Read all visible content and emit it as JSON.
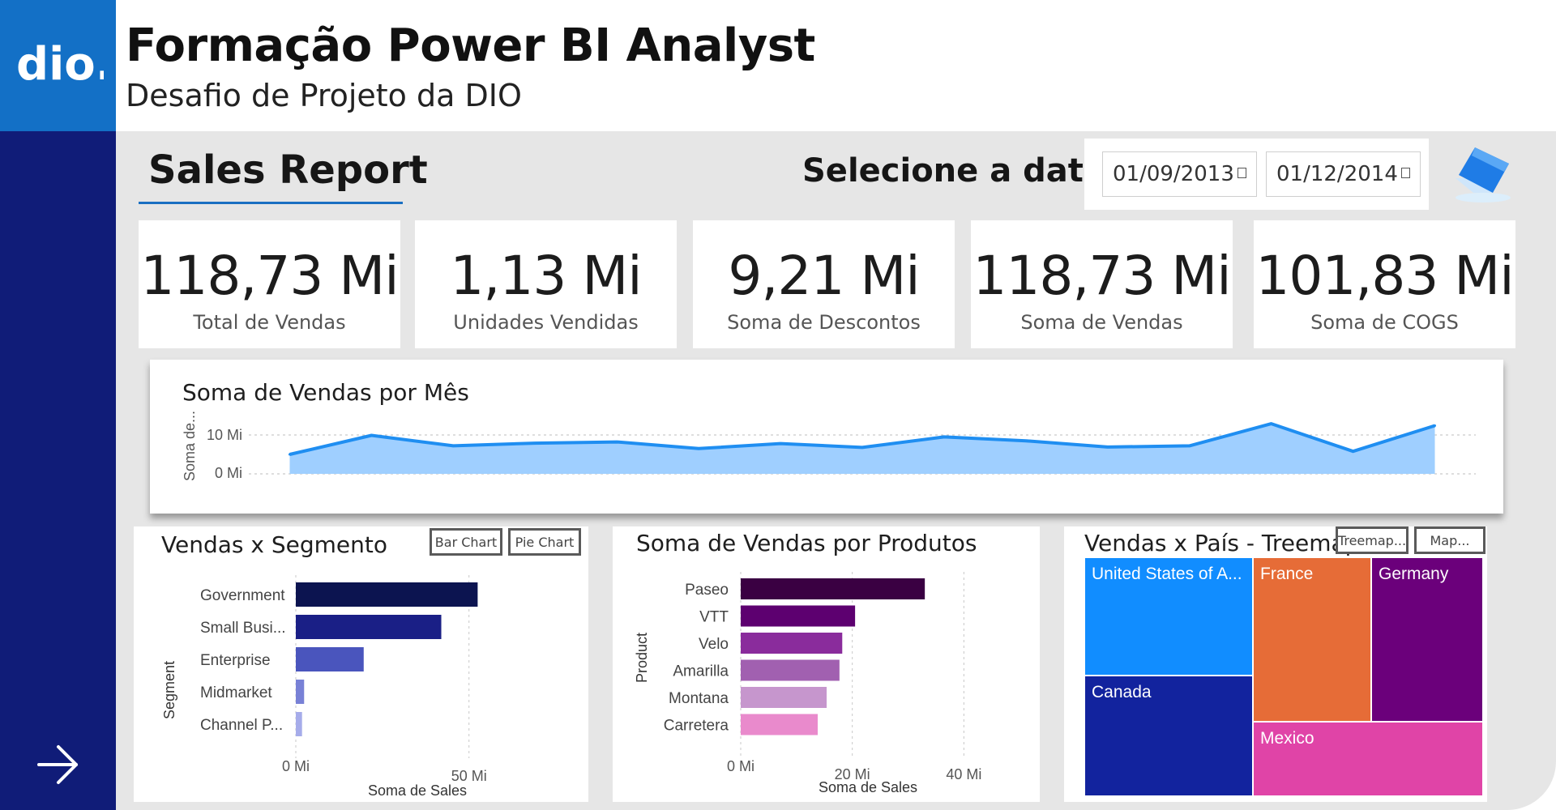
{
  "header": {
    "logo_text": "dio.",
    "title": "Formação Power BI Analyst",
    "subtitle": "Desafio de Projeto da DIO"
  },
  "colors": {
    "brand_blue": "#1370c6",
    "rail_navy": "#101c78",
    "canvas_gray": "#e6e6e6",
    "area_line": "#1f8ef1",
    "area_fill": "#9fcfff"
  },
  "report": {
    "title": "Sales Report",
    "date_label": "Selecione a data",
    "date_start": "01/09/2013",
    "date_end": "01/12/2014",
    "clear_icon": "eraser-icon",
    "nav_icon": "arrow-right-icon"
  },
  "kpis": [
    {
      "value": "118,73 Mi",
      "label": "Total de Vendas"
    },
    {
      "value": "1,13 Mi",
      "label": "Unidades Vendidas"
    },
    {
      "value": "9,21 Mi",
      "label": "Soma de Descontos"
    },
    {
      "value": "118,73 Mi",
      "label": "Soma de Vendas"
    },
    {
      "value": "101,83 Mi",
      "label": "Soma de COGS"
    }
  ],
  "monthly": {
    "title": "Soma de Vendas por Mês",
    "ylabel": "Soma de...",
    "yticks": [
      "10 Mi",
      "0 Mi"
    ]
  },
  "segment": {
    "title": "Vendas x Segmento",
    "buttons": [
      "Bar Chart",
      "Pie Chart"
    ],
    "ylabel": "Segment",
    "xlabel": "Soma de Sales",
    "xticks": [
      "0 Mi",
      "50 Mi"
    ]
  },
  "products": {
    "title": "Soma de Vendas por Produtos",
    "ylabel": "Product",
    "xlabel": "Soma de Sales",
    "xticks": [
      "0 Mi",
      "20 Mi",
      "40 Mi"
    ]
  },
  "country": {
    "title": "Vendas x País - Treemap",
    "buttons": [
      "Treemap...",
      "Map..."
    ],
    "cells": [
      {
        "label": "United States of A...",
        "value": 25.0,
        "color": "#118dff"
      },
      {
        "label": "Canada",
        "value": 24.9,
        "color": "#12239e"
      },
      {
        "label": "France",
        "value": 24.4,
        "color": "#e66c37"
      },
      {
        "label": "Germany",
        "value": 23.5,
        "color": "#6b007b"
      },
      {
        "label": "Mexico",
        "value": 20.9,
        "color": "#e044a7"
      }
    ]
  },
  "chart_data": [
    {
      "type": "area",
      "title": "Soma de Vendas por Mês",
      "xlabel": "",
      "ylabel": "Soma de...",
      "ylim": [
        0,
        14
      ],
      "ytick_values": [
        0,
        10
      ],
      "grid": true,
      "values": [
        5.0,
        9.9,
        7.2,
        7.9,
        8.2,
        6.5,
        7.8,
        6.8,
        9.5,
        8.5,
        6.9,
        7.2,
        12.9,
        5.8,
        12.4
      ]
    },
    {
      "type": "bar",
      "orientation": "horizontal",
      "title": "Vendas x Segmento",
      "xlabel": "Soma de Sales",
      "ylabel": "Segment",
      "categories": [
        "Government",
        "Small Busi...",
        "Enterprise",
        "Midmarket",
        "Channel P..."
      ],
      "values": [
        52.5,
        42.0,
        19.6,
        2.4,
        1.8
      ],
      "colors": [
        "#0c1450",
        "#1a1f86",
        "#4a55bd",
        "#7881d6",
        "#a6acea"
      ],
      "xlim": [
        0,
        62
      ],
      "xtick_values": [
        0,
        50
      ]
    },
    {
      "type": "bar",
      "orientation": "horizontal",
      "title": "Soma de Vendas por Produtos",
      "xlabel": "Soma de Sales",
      "ylabel": "Product",
      "categories": [
        "Paseo",
        "VTT",
        "Velo",
        "Amarilla",
        "Montana",
        "Carretera"
      ],
      "values": [
        33.0,
        20.5,
        18.2,
        17.7,
        15.4,
        13.8
      ],
      "colors": [
        "#3a0042",
        "#5d0070",
        "#8a2c9c",
        "#a160b0",
        "#c696cd",
        "#e98acc"
      ],
      "xlim": [
        0,
        43
      ],
      "xtick_values": [
        0,
        20,
        40
      ]
    }
  ]
}
